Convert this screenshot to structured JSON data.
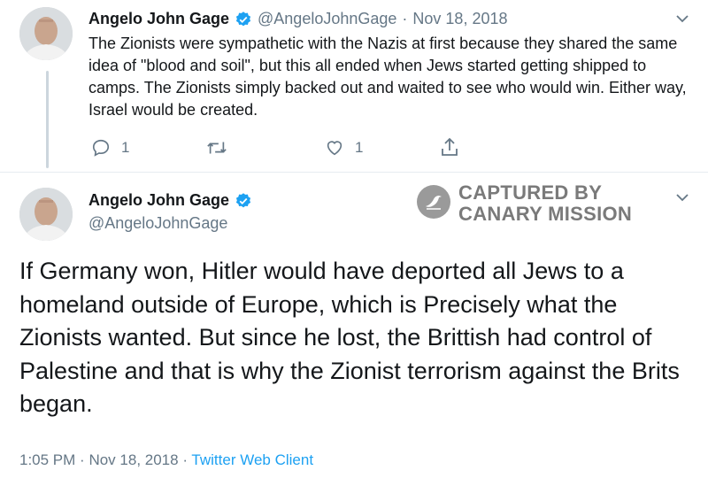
{
  "tweet1": {
    "author_name": "Angelo John Gage",
    "handle": "@AngeloJohnGage",
    "separator": "·",
    "date": "Nov 18, 2018",
    "text": "The Zionists were sympathetic with the Nazis at first because they shared the same idea of \"blood and soil\", but this all ended when Jews started getting shipped to camps. The Zionists simply backed out and waited to see who would win. Either way, Israel would be created.",
    "reply_count": "1",
    "like_count": "1",
    "icons": [
      "reply-icon",
      "retweet-icon",
      "like-icon",
      "share-icon",
      "chevron-down-icon",
      "verified-icon"
    ]
  },
  "tweet2": {
    "author_name": "Angelo John Gage",
    "handle": "@AngeloJohnGage",
    "text": "If Germany won, Hitler would have deported all Jews to a homeland outside of Europe, which is Precisely what the Zionists wanted. But since he lost, the Brittish had control of Palestine and that is why the Zionist terrorism against the Brits began.",
    "time": "1:05 PM",
    "date": "Nov 18, 2018",
    "separator": "·",
    "client": "Twitter Web Client"
  },
  "watermark": {
    "line1": "CAPTURED BY",
    "line2": "CANARY MISSION"
  },
  "colors": {
    "text": "#14171a",
    "secondary": "#657786",
    "link": "#1da1f2",
    "verified": "#1da1f2",
    "watermark": "#7a7a7a"
  }
}
